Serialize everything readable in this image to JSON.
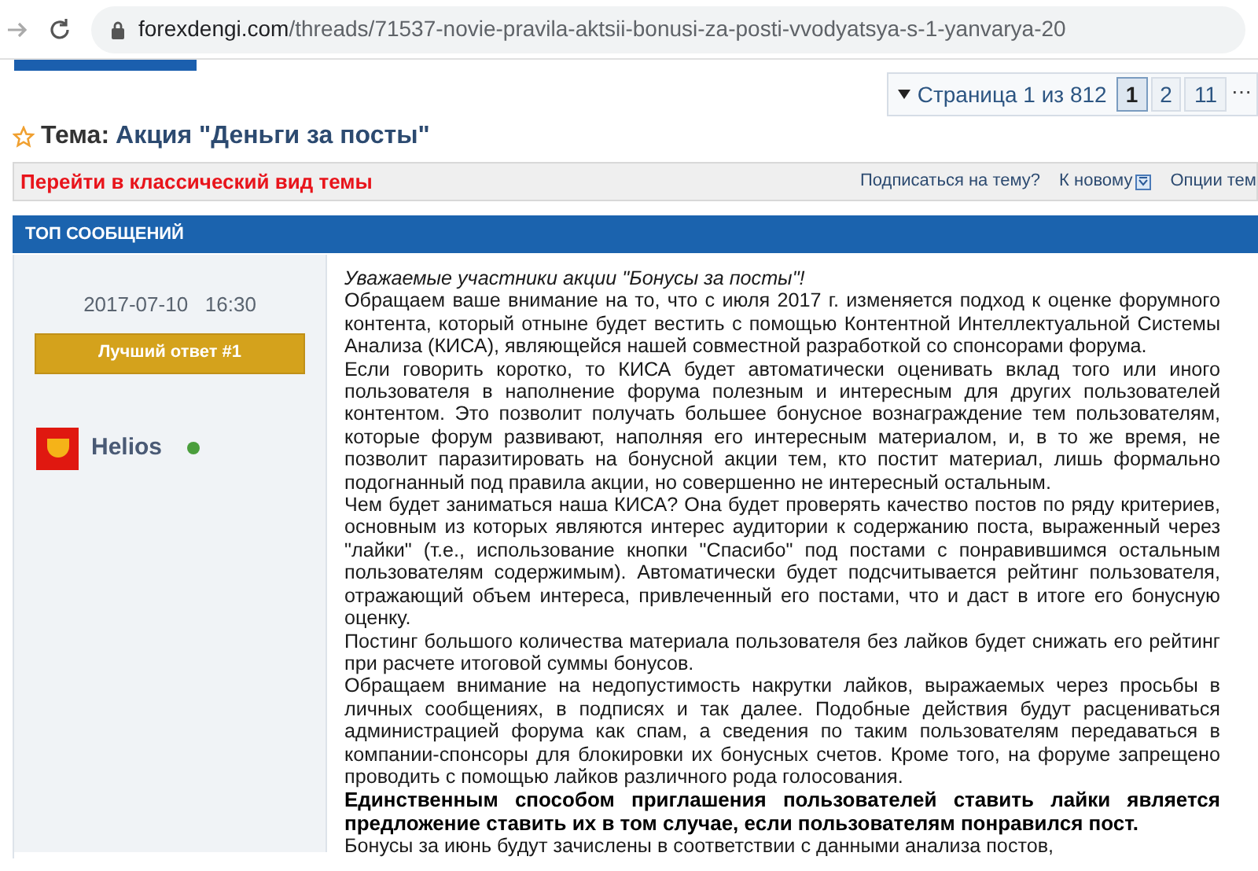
{
  "browser": {
    "url_domain": "forexdengi.com",
    "url_path": "/threads/71537-novie-pravila-aktsii-bonusi-za-posti-vvodyatsya-s-1-yanvarya-20"
  },
  "pagination": {
    "label": "Страница 1 из 812",
    "pages": [
      {
        "label": "1",
        "selected": true
      },
      {
        "label": "2",
        "selected": false
      },
      {
        "label": "11",
        "selected": false
      }
    ],
    "more": "⋯"
  },
  "thread": {
    "prefix": "Тема:",
    "title": "Акция \"Деньги за посты\""
  },
  "toolbar": {
    "classic_link": "Перейти в классический вид темы",
    "links": [
      "Подписаться на тему?",
      "К новому",
      "Опции тем"
    ]
  },
  "section_header": "ТОП СООБЩЕНИЙ",
  "post": {
    "date": "2017-07-10",
    "time": "16:30",
    "badge": "Лучший ответ #1",
    "author": "Helios",
    "online": true,
    "paragraphs": [
      {
        "kind": "italic",
        "text": "Уважаемые участники акции \"Бонусы за посты\"!"
      },
      {
        "kind": "normal",
        "text": "Обращаем ваше внимание на то, что с июля 2017 г. изменяется подход к оценке форумного контента, который отныне будет вестить с помощью Контентной Интеллектуальной Системы Анализа (КИСА), являющейся нашей совместной разработкой со спонсорами форума."
      },
      {
        "kind": "normal",
        "text": "Если говорить коротко, то КИСА будет автоматически оценивать вклад того или иного пользователя в наполнение форума полезным и интересным для других пользователей контентом. Это позволит получать большее бонусное вознаграждение тем пользователям, которые форум развивают, наполняя его интересным материалом, и, в то же время, не позволит паразитировать на бонусной акции тем, кто постит материал, лишь формально подогнанный под правила акции, но совершенно не интересный остальным."
      },
      {
        "kind": "normal",
        "text": "Чем будет заниматься наша КИСА? Она будет проверять качество постов по ряду критериев, основным из которых являются интерес аудитории к содержанию поста, выраженный через \"лайки\" (т.е., использование кнопки \"Спасибо\" под постами с понравившимся остальным пользователям содержимым). Автоматически будет подсчитывается рейтинг пользователя, отражающий объем интереса, привлеченный его постами, что и даст в итоге его бонусную оценку."
      },
      {
        "kind": "normal",
        "text": "Постинг большого количества материала пользователя без лайков будет снижать его рейтинг при расчете итоговой суммы бонусов."
      },
      {
        "kind": "normal",
        "text": "Обращаем внимание на недопустимость накрутки лайков, выражаемых через просьбы в личных сообщениях, в подписях и так далее. Подобные действия будут расцениваться администрацией форума как спам, а сведения по таким пользователям передаваться в компании-спонсоры для блокировки их бонусных счетов. Кроме того, на форуме запрещено проводить с помощью лайков различного рода голосования."
      },
      {
        "kind": "bold",
        "text": "Единственным способом приглашения пользователей ставить лайки является предложение ставить их в том случае, если пользователям понравился пост."
      },
      {
        "kind": "normal",
        "text": "Бонусы за июнь будут зачислены в соответствии с данными анализа постов,"
      }
    ]
  }
}
